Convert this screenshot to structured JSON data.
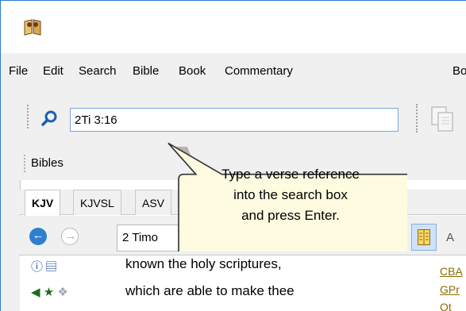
{
  "menubar": {
    "items": [
      "File",
      "Edit",
      "Search",
      "Bible",
      "Book",
      "Commentary",
      "Bo"
    ]
  },
  "search": {
    "value": "2Ti 3:16"
  },
  "panel": {
    "title": "Bibles"
  },
  "tabs": [
    {
      "label": "KJV",
      "active": true
    },
    {
      "label": "KJVSL",
      "active": false
    },
    {
      "label": "ASV",
      "active": false
    }
  ],
  "nav": {
    "book_value": "2 Timo",
    "partial_label": "A"
  },
  "verse": {
    "line1": "known the holy scriptures,",
    "line2": "which are able to make thee"
  },
  "cross_refs": [
    "CBA",
    "GPr",
    "Ot"
  ],
  "callout": {
    "lines": [
      "Type a verse reference",
      "into the search box",
      "and press Enter."
    ]
  },
  "colors": {
    "accent_blue": "#2f7fd1",
    "callout_fill": "#fefbe0",
    "cross_ref": "#8a6d00"
  },
  "icons": [
    "app-icon",
    "search-icon",
    "copy-icon",
    "back-icon",
    "forward-icon",
    "layout-icon"
  ]
}
